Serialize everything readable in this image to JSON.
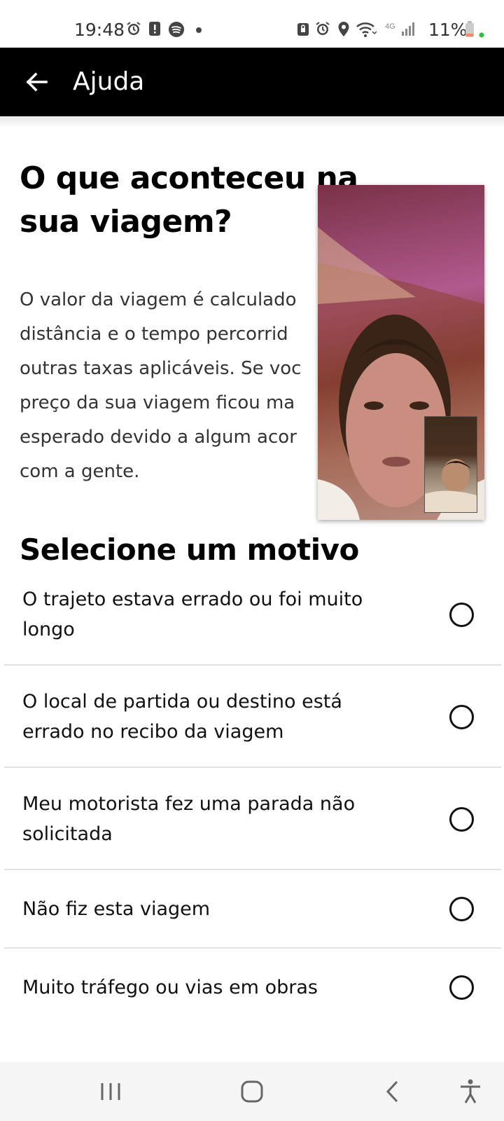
{
  "status_bar": {
    "time": "19:48",
    "battery_percent": "11%",
    "network": "4G",
    "left_icons": [
      "alarm-icon",
      "alert-icon",
      "spotify-icon",
      "dot-icon"
    ],
    "right_icons": [
      "lock-icon",
      "alarm-icon",
      "location-icon",
      "wifi-icon",
      "signal-icon",
      "battery-icon"
    ]
  },
  "app_bar": {
    "title": "Ajuda",
    "back_icon": "back-arrow-icon"
  },
  "main": {
    "heading": "O que aconteceu na sua viagem?",
    "body_lines": [
      "O valor da viagem é calculado",
      "distância e o tempo percorrid",
      "outras taxas aplicáveis. Se voc",
      "preço da sua viagem ficou ma",
      "esperado devido a algum acor",
      "com a gente."
    ],
    "section_title": "Selecione um motivo",
    "options": [
      {
        "label": "O trajeto estava errado ou foi muito longo",
        "selected": false
      },
      {
        "label": "O local de partida ou destino está errado no recibo da viagem",
        "selected": false
      },
      {
        "label": "Meu motorista fez uma parada não solicitada",
        "selected": false
      },
      {
        "label": "Não fiz esta viagem",
        "selected": false
      },
      {
        "label": "Muito tráfego ou vias em obras",
        "selected": false
      }
    ]
  },
  "nav_bar": {
    "buttons": [
      "recent-apps-icon",
      "home-icon",
      "back-icon",
      "accessibility-icon"
    ]
  },
  "colors": {
    "app_bar": "#000000",
    "text": "#000000",
    "divider": "#e2e2e2",
    "nav_bar": "#f5f5f5"
  }
}
